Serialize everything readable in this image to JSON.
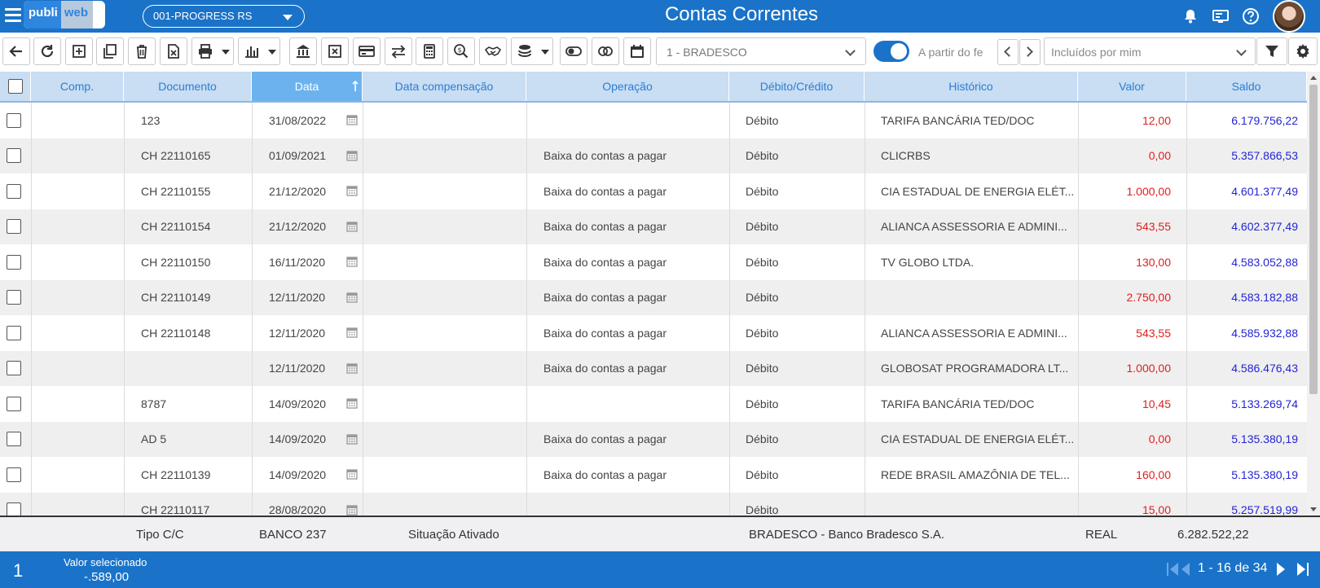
{
  "header": {
    "logo_left": "publi",
    "logo_right": "web",
    "company": "001-PROGRESS RS",
    "title": "Contas Correntes"
  },
  "toolbar": {
    "bank_select": "1 - BRADESCO",
    "toggle_label": "A partir do fe",
    "filter_select": "Incluídos por mim"
  },
  "columns": [
    "Comp.",
    "Documento",
    "Data",
    "Data compensação",
    "Operação",
    "Débito/Crédito",
    "Histórico",
    "Valor",
    "Saldo"
  ],
  "rows": [
    {
      "comp": "",
      "documento": "123",
      "data": "31/08/2022",
      "compensacao": "",
      "operacao": "",
      "dc": "Débito",
      "historico": "TARIFA BANCÁRIA TED/DOC",
      "valor": "12,00",
      "saldo": "6.179.756,22"
    },
    {
      "comp": "",
      "documento": "CH 22110165",
      "data": "01/09/2021",
      "compensacao": "",
      "operacao": "Baixa do contas a pagar",
      "dc": "Débito",
      "historico": "CLICRBS",
      "valor": "0,00",
      "saldo": "5.357.866,53"
    },
    {
      "comp": "",
      "documento": "CH 22110155",
      "data": "21/12/2020",
      "compensacao": "",
      "operacao": "Baixa do contas a pagar",
      "dc": "Débito",
      "historico": "CIA ESTADUAL DE ENERGIA ELÉT...",
      "valor": "1.000,00",
      "saldo": "4.601.377,49"
    },
    {
      "comp": "",
      "documento": "CH 22110154",
      "data": "21/12/2020",
      "compensacao": "",
      "operacao": "Baixa do contas a pagar",
      "dc": "Débito",
      "historico": "ALIANCA ASSESSORIA E ADMINI...",
      "valor": "543,55",
      "saldo": "4.602.377,49"
    },
    {
      "comp": "",
      "documento": "CH 22110150",
      "data": "16/11/2020",
      "compensacao": "",
      "operacao": "Baixa do contas a pagar",
      "dc": "Débito",
      "historico": "TV GLOBO LTDA.",
      "valor": "130,00",
      "saldo": "4.583.052,88"
    },
    {
      "comp": "",
      "documento": "CH 22110149",
      "data": "12/11/2020",
      "compensacao": "",
      "operacao": "Baixa do contas a pagar",
      "dc": "Débito",
      "historico": "",
      "valor": "2.750,00",
      "saldo": "4.583.182,88"
    },
    {
      "comp": "",
      "documento": "CH 22110148",
      "data": "12/11/2020",
      "compensacao": "",
      "operacao": "Baixa do contas a pagar",
      "dc": "Débito",
      "historico": "ALIANCA ASSESSORIA E ADMINI...",
      "valor": "543,55",
      "saldo": "4.585.932,88"
    },
    {
      "comp": "",
      "documento": "",
      "data": "12/11/2020",
      "compensacao": "",
      "operacao": "Baixa do contas a pagar",
      "dc": "Débito",
      "historico": "GLOBOSAT PROGRAMADORA LT...",
      "valor": "1.000,00",
      "saldo": "4.586.476,43"
    },
    {
      "comp": "",
      "documento": "8787",
      "data": "14/09/2020",
      "compensacao": "",
      "operacao": "",
      "dc": "Débito",
      "historico": "TARIFA BANCÁRIA TED/DOC",
      "valor": "10,45",
      "saldo": "5.133.269,74"
    },
    {
      "comp": "",
      "documento": "AD 5",
      "data": "14/09/2020",
      "compensacao": "",
      "operacao": "Baixa do contas a pagar",
      "dc": "Débito",
      "historico": "CIA ESTADUAL DE ENERGIA ELÉT...",
      "valor": "0,00",
      "saldo": "5.135.380,19"
    },
    {
      "comp": "",
      "documento": "CH 22110139",
      "data": "14/09/2020",
      "compensacao": "",
      "operacao": "Baixa do contas a pagar",
      "dc": "Débito",
      "historico": "REDE BRASIL AMAZÔNIA DE TEL...",
      "valor": "160,00",
      "saldo": "5.135.380,19"
    },
    {
      "comp": "",
      "documento": "CH 22110117",
      "data": "28/08/2020",
      "compensacao": "",
      "operacao": "",
      "dc": "Débito",
      "historico": "",
      "valor": "15,00",
      "saldo": "5.257.519,99"
    }
  ],
  "summary": {
    "tipo": "Tipo C/C",
    "banco": "BANCO 237",
    "situacao": "Situação Ativado",
    "nome_banco": "BRADESCO - Banco Bradesco S.A.",
    "moeda": "REAL",
    "saldo": "6.282.522,22"
  },
  "footer": {
    "count": "1",
    "valor_label": "Valor selecionado",
    "valor_value": "-.589,00",
    "pager": "1 - 16 de 34"
  },
  "colors": {
    "primary": "#1a73c8",
    "header_row": "#c9ddf3",
    "active_header": "#6cb2ee",
    "debit_value": "#e02020",
    "balance": "#2323d6"
  }
}
